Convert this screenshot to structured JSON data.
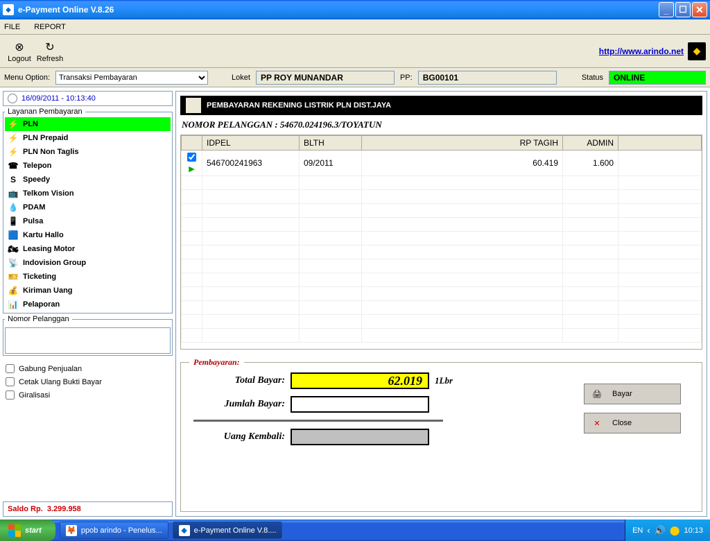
{
  "window": {
    "title": "e-Payment Online V.8.26"
  },
  "menu": {
    "file": "FILE",
    "report": "REPORT"
  },
  "toolbar": {
    "logout": "Logout",
    "refresh": "Refresh",
    "link": "http://www.arindo.net"
  },
  "optbar": {
    "menuopt_label": "Menu Option:",
    "menuopt_value": "Transaksi Pembayaran",
    "loket_label": "Loket",
    "loket_value": "PP ROY MUNANDAR",
    "pp_label": "PP:",
    "pp_value": "BG00101",
    "status_label": "Status",
    "status_value": "ONLINE"
  },
  "left": {
    "datetime": "16/09/2011 - 10:13:40",
    "services_legend": "Layanan Pembayaran",
    "services": [
      {
        "icon": "⚡",
        "label": "PLN",
        "sel": true
      },
      {
        "icon": "⚡",
        "label": "PLN Prepaid"
      },
      {
        "icon": "⚡",
        "label": "PLN Non Taglis"
      },
      {
        "icon": "☎",
        "label": "Telepon"
      },
      {
        "icon": "S",
        "label": "Speedy"
      },
      {
        "icon": "📺",
        "label": "Telkom Vision"
      },
      {
        "icon": "💧",
        "label": "PDAM"
      },
      {
        "icon": "📱",
        "label": "Pulsa"
      },
      {
        "icon": "🟦",
        "label": "Kartu Hallo"
      },
      {
        "icon": "🏍",
        "label": "Leasing Motor"
      },
      {
        "icon": "📡",
        "label": "Indovision Group"
      },
      {
        "icon": "🎫",
        "label": "Ticketing"
      },
      {
        "icon": "💰",
        "label": "Kiriman Uang"
      },
      {
        "icon": "📊",
        "label": "Pelaporan"
      }
    ],
    "nopel_legend": "Nomor Pelanggan",
    "chk1": "Gabung Penjualan",
    "chk2": "Cetak Ulang Bukti Bayar",
    "chk3": "Giralisasi",
    "saldo_label": "Saldo Rp.",
    "saldo_value": "3.299.958"
  },
  "main": {
    "title": "PEMBAYARAN REKENING LISTRIK PLN DIST.JAYA",
    "customer_label": "NOMOR PELANGGAN : 54670.024196.3/TOYATUN",
    "cols": {
      "idpel": "IDPEL",
      "blth": "BLTH",
      "tagih": "RP TAGIH",
      "admin": "ADMIN"
    },
    "row": {
      "idpel": "546700241963",
      "blth": "09/2011",
      "tagih": "60.419",
      "admin": "1.600"
    },
    "pay": {
      "legend": "Pembayaran:",
      "total_label": "Total Bayar:",
      "total_value": "62.019",
      "total_suffix": "1Lbr",
      "jumlah_label": "Jumlah Bayar:",
      "kembali_label": "Uang Kembali:",
      "bayar_btn": "Bayar",
      "close_btn": "Close"
    }
  },
  "taskbar": {
    "start": "start",
    "item1": "ppob arindo - Penelus...",
    "item2": "e-Payment Online V.8....",
    "lang": "EN",
    "clock": "10:13"
  }
}
